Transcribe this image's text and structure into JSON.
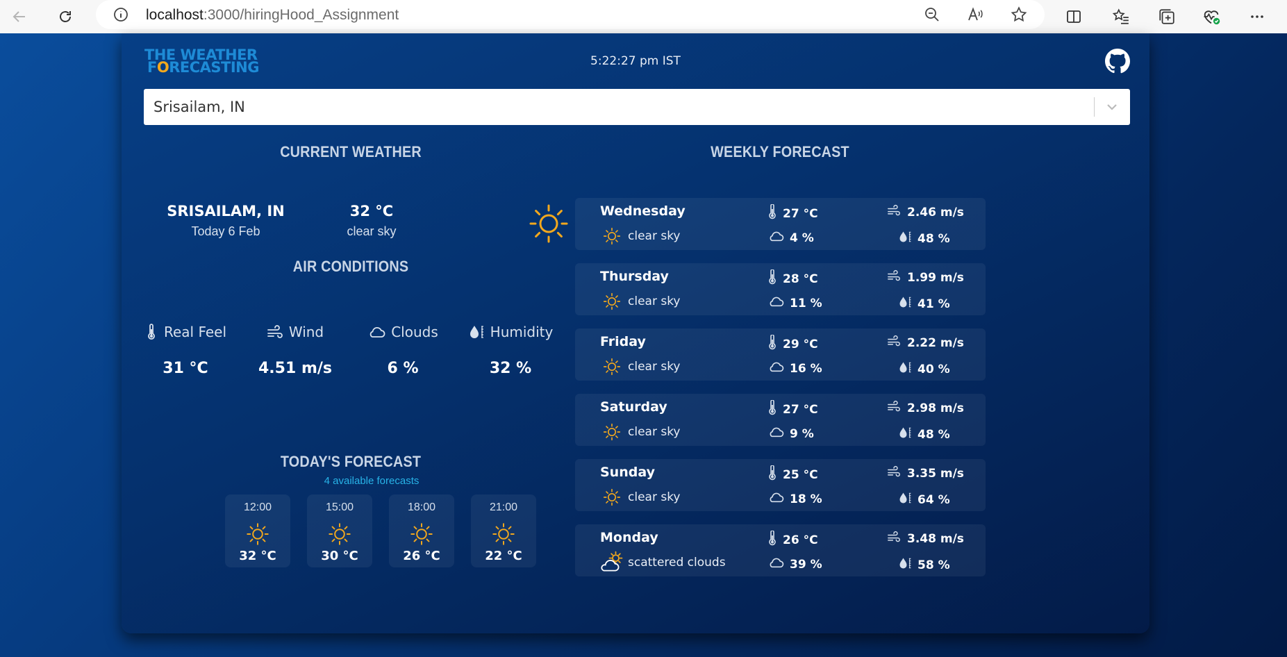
{
  "browser": {
    "url_host": "localhost",
    "url_path": ":3000/hiringHood_Assignment"
  },
  "header": {
    "logo_line1": "The Weather",
    "logo_line2_pre": "F",
    "logo_line2_o": "o",
    "logo_line2_post": "recasting",
    "time": "5:22:27 pm IST"
  },
  "search": {
    "value": "Srisailam, IN"
  },
  "current": {
    "title": "CURRENT WEATHER",
    "city": "SRISAILAM, IN",
    "date": "Today 6 Feb",
    "temp": "32 °C",
    "description": "clear sky",
    "icon": "sun-icon"
  },
  "air": {
    "title": "AIR CONDITIONS",
    "items": [
      {
        "label": "Real Feel",
        "value": "31 °C",
        "icon": "thermometer-icon"
      },
      {
        "label": "Wind",
        "value": "4.51 m/s",
        "icon": "wind-icon"
      },
      {
        "label": "Clouds",
        "value": "6 %",
        "icon": "cloud-icon"
      },
      {
        "label": "Humidity",
        "value": "32 %",
        "icon": "humidity-icon"
      }
    ]
  },
  "today": {
    "title": "TODAY'S FORECAST",
    "subtitle": "4 available forecasts",
    "hours": [
      {
        "time": "12:00",
        "temp": "32 °C"
      },
      {
        "time": "15:00",
        "temp": "30 °C"
      },
      {
        "time": "18:00",
        "temp": "26 °C"
      },
      {
        "time": "21:00",
        "temp": "22 °C"
      }
    ]
  },
  "weekly": {
    "title": "WEEKLY FORECAST",
    "days": [
      {
        "day": "Wednesday",
        "temp": "27 °C",
        "wind": "2.46 m/s",
        "desc": "clear sky",
        "clouds": "4 %",
        "humidity": "48 %",
        "icon": "sun-icon"
      },
      {
        "day": "Thursday",
        "temp": "28 °C",
        "wind": "1.99 m/s",
        "desc": "clear sky",
        "clouds": "11 %",
        "humidity": "41 %",
        "icon": "sun-icon"
      },
      {
        "day": "Friday",
        "temp": "29 °C",
        "wind": "2.22 m/s",
        "desc": "clear sky",
        "clouds": "16 %",
        "humidity": "40 %",
        "icon": "sun-icon"
      },
      {
        "day": "Saturday",
        "temp": "27 °C",
        "wind": "2.98 m/s",
        "desc": "clear sky",
        "clouds": "9 %",
        "humidity": "48 %",
        "icon": "sun-icon"
      },
      {
        "day": "Sunday",
        "temp": "25 °C",
        "wind": "3.35 m/s",
        "desc": "clear sky",
        "clouds": "18 %",
        "humidity": "64 %",
        "icon": "sun-icon"
      },
      {
        "day": "Monday",
        "temp": "26 °C",
        "wind": "3.48 m/s",
        "desc": "scattered clouds",
        "clouds": "39 %",
        "humidity": "58 %",
        "icon": "cloud-sun-icon"
      }
    ]
  },
  "colors": {
    "accent_sun": "#f2a81d",
    "accent_link": "#28b3e7",
    "logo_blue": "#1e8bd6"
  }
}
